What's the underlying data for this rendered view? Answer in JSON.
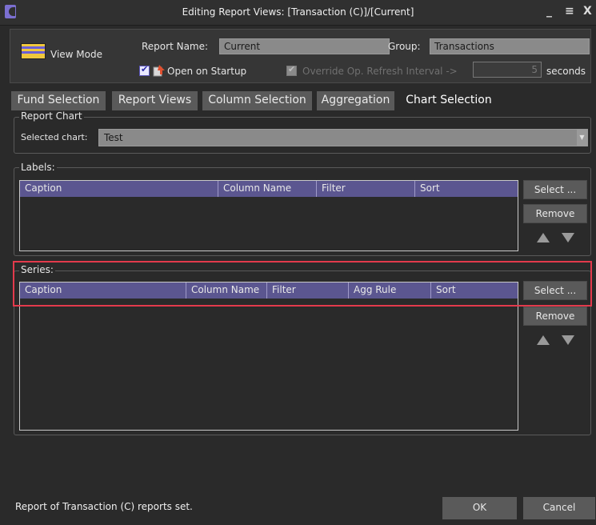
{
  "window": {
    "title": "Editing Report Views: [Transaction (C)]/[Current]",
    "minimize": "_",
    "maximize": "≡",
    "close": "X"
  },
  "header": {
    "view_mode_label": "View Mode",
    "report_name_label": "Report Name:",
    "report_name_value": "Current",
    "group_label": "Group:",
    "group_value": "Transactions",
    "open_on_startup_label": "Open on Startup",
    "open_on_startup_checked": true,
    "override_label": "Override Op. Refresh Interval ->",
    "override_checked": true,
    "refresh_interval_value": "5",
    "seconds_label": "seconds"
  },
  "tabs": [
    {
      "label": "Fund Selection",
      "active": false
    },
    {
      "label": "Report Views",
      "active": false
    },
    {
      "label": "Column Selection",
      "active": false
    },
    {
      "label": "Aggregation",
      "active": false
    },
    {
      "label": "Chart Selection",
      "active": true
    }
  ],
  "report_chart": {
    "legend": "Report Chart",
    "selected_chart_label": "Selected chart:",
    "selected_chart_value": "Test"
  },
  "labels_section": {
    "legend": "Labels:",
    "columns": [
      "Caption",
      "Column Name",
      "Filter",
      "Sort"
    ],
    "rows": [],
    "select_button": "Select ...",
    "remove_button": "Remove"
  },
  "series_section": {
    "legend": "Series:",
    "columns": [
      "Caption",
      "Column Name",
      "Filter",
      "Agg Rule",
      "Sort"
    ],
    "rows": [],
    "select_button": "Select ...",
    "remove_button": "Remove"
  },
  "footer": {
    "status_text": "Report of Transaction (C) reports set.",
    "ok_button": "OK",
    "cancel_button": "Cancel"
  },
  "colors": {
    "background": "#2a2a2a",
    "grid_header": "#5b5690",
    "highlight": "#e33a4c",
    "button": "#5a5a5a"
  }
}
